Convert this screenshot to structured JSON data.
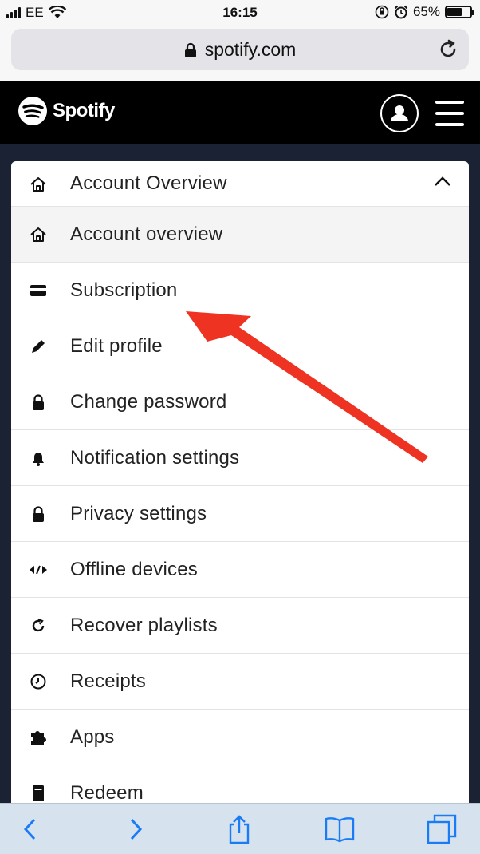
{
  "status_bar": {
    "carrier": "EE",
    "time": "16:15",
    "battery": "65%",
    "battery_level": 0.65
  },
  "browser": {
    "url": "spotify.com"
  },
  "spotify": {
    "brand": "Spotify"
  },
  "menu": {
    "section_title": "Account Overview",
    "items": [
      {
        "label": "Account overview",
        "icon": "home-icon",
        "active": true
      },
      {
        "label": "Subscription",
        "icon": "card-icon"
      },
      {
        "label": "Edit profile",
        "icon": "pencil-icon"
      },
      {
        "label": "Change password",
        "icon": "lock-icon"
      },
      {
        "label": "Notification settings",
        "icon": "bell-icon"
      },
      {
        "label": "Privacy settings",
        "icon": "lock-icon"
      },
      {
        "label": "Offline devices",
        "icon": "offline-devices-icon"
      },
      {
        "label": "Recover playlists",
        "icon": "recover-icon"
      },
      {
        "label": "Receipts",
        "icon": "clock-icon"
      },
      {
        "label": "Apps",
        "icon": "puzzle-icon"
      },
      {
        "label": "Redeem",
        "icon": "redeem-icon"
      }
    ]
  },
  "colors": {
    "annotation_arrow": "#ee3322",
    "spotify_header": "#000000",
    "page_bg": "#1b2233",
    "safari_tint": "#1a7cf5"
  }
}
